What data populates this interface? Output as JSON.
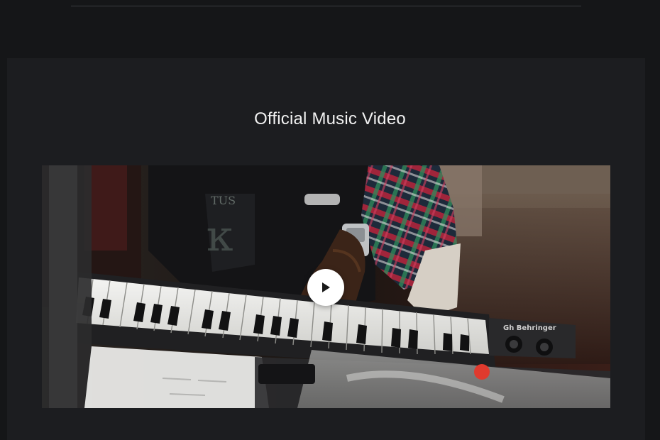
{
  "section": {
    "title": "Official Music Video"
  },
  "video": {
    "thumbnail": "musician-playing-keyboard-thumbnail",
    "play_icon": "play-icon",
    "keyboard_brand": "Gh Behringer"
  },
  "colors": {
    "page_background": "#151618",
    "section_background": "#1c1d20",
    "title_text": "#f2f2f2",
    "play_button": "#ffffff"
  }
}
